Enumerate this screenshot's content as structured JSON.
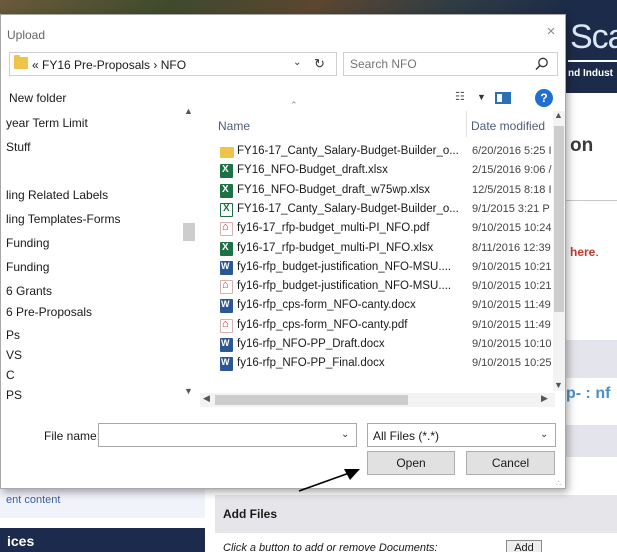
{
  "background_page": {
    "brand_text": "Sca",
    "brand_subtext": "nd Indust",
    "heading_fragment": "on",
    "here_link": "here",
    "here_dot": ".",
    "nfo_fragment": "p- : nf",
    "recent_content": "ent content",
    "services": "ices",
    "add_files": "Add Files",
    "instruction": "Click a button to add or remove Documents:",
    "add_button": "Add"
  },
  "dialog": {
    "title": "Upload",
    "close_glyph": "×",
    "breadcrumb": "« FY16 Pre-Proposals › NFO",
    "search_placeholder": "Search NFO",
    "new_folder": "New folder",
    "nav_items": [
      "year Term Limit",
      "Stuff",
      "",
      "ling Related Labels",
      "ling Templates-Forms",
      " Funding",
      " Funding",
      "6 Grants",
      "6 Pre-Proposals",
      "Ps",
      "VS",
      "C",
      "PS"
    ],
    "columns": {
      "name": "Name",
      "date": "Date modified"
    },
    "files": [
      {
        "icon": "folder-icon",
        "name": "FY16-17_Canty_Salary-Budget-Builder_o...",
        "date": "6/20/2016 5:25 I"
      },
      {
        "icon": "excel-icon",
        "name": "FY16_NFO-Budget_draft.xlsx",
        "date": "2/15/2016 9:06 /"
      },
      {
        "icon": "excel-icon",
        "name": "FY16_NFO-Budget_draft_w75wp.xlsx",
        "date": "12/5/2015 8:18 I"
      },
      {
        "icon": "excel-alt-icon",
        "name": "FY16-17_Canty_Salary-Budget-Builder_o...",
        "date": "9/1/2015 3:21 P"
      },
      {
        "icon": "pdf-icon",
        "name": "fy16-17_rfp-budget_multi-PI_NFO.pdf",
        "date": "9/10/2015 10:24"
      },
      {
        "icon": "excel-icon",
        "name": "fy16-17_rfp-budget_multi-PI_NFO.xlsx",
        "date": "8/11/2016 12:39"
      },
      {
        "icon": "word-icon",
        "name": "fy16-rfp_budget-justification_NFO-MSU....",
        "date": "9/10/2015 10:21"
      },
      {
        "icon": "pdf-icon",
        "name": "fy16-rfp_budget-justification_NFO-MSU....",
        "date": "9/10/2015 10:21"
      },
      {
        "icon": "word-icon",
        "name": "fy16-rfp_cps-form_NFO-canty.docx",
        "date": "9/10/2015 11:49"
      },
      {
        "icon": "pdf-icon",
        "name": "fy16-rfp_cps-form_NFO-canty.pdf",
        "date": "9/10/2015 11:49"
      },
      {
        "icon": "word-icon",
        "name": "fy16-rfp_NFO-PP_Draft.docx",
        "date": "9/10/2015 10:10"
      },
      {
        "icon": "word-icon",
        "name": "fy16-rfp_NFO-PP_Final.docx",
        "date": "9/10/2015 10:25"
      }
    ],
    "file_name_label": "File name:",
    "file_name_value": "",
    "filter_label": "All Files (*.*)",
    "open_button": "Open",
    "cancel_button": "Cancel"
  },
  "colors": {
    "accent": "#1f6fd0",
    "brand_navy": "#1c2b4d",
    "link_red": "#c0392b"
  }
}
